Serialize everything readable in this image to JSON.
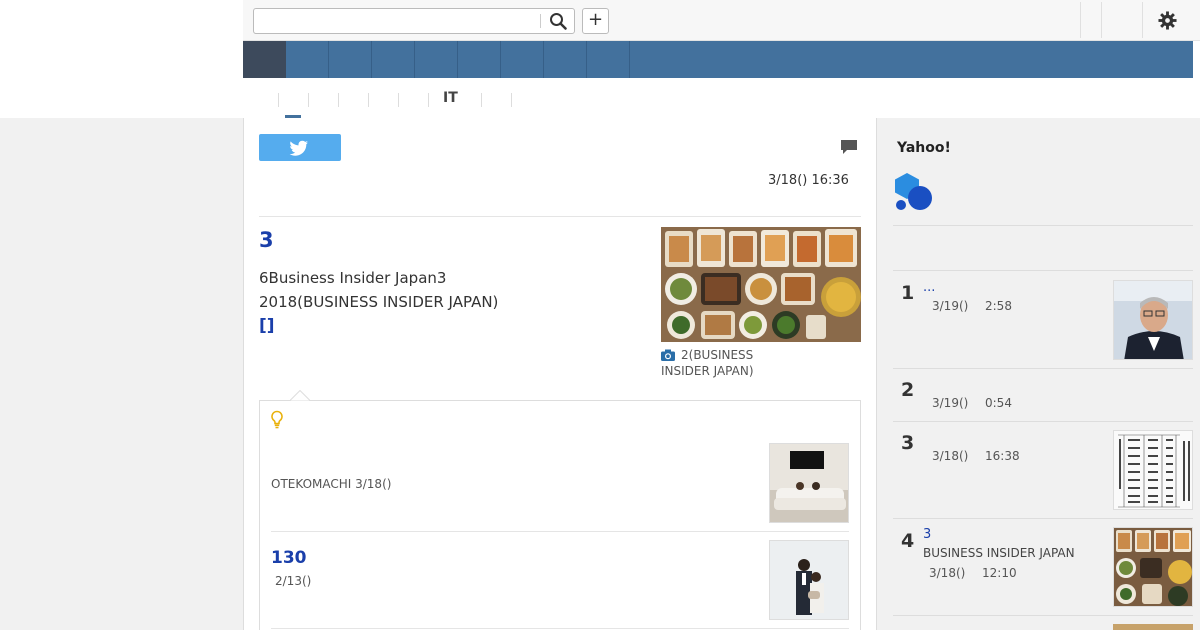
{
  "search": {
    "placeholder": "",
    "plus_label": "+"
  },
  "subnav": {
    "items": [
      "IT"
    ]
  },
  "article": {
    "date": "3/18() 16:36",
    "title": "3",
    "body_line_1": "6Business Insider Japan3",
    "body_line_2": "2018(BUSINESS INSIDER JAPAN)",
    "link": "[]",
    "photo_caption": "2(BUSINESS INSIDER JAPAN)"
  },
  "related": [
    {
      "title": "",
      "source_date": "OTEKOMACHI 3/18()"
    },
    {
      "title": "130",
      "date": "2/13()"
    }
  ],
  "sidebar": {
    "heading": "Yahoo!",
    "ranking": [
      {
        "rank": "1",
        "title": "...",
        "date": "3/19()",
        "time": "2:58",
        "source": ""
      },
      {
        "rank": "2",
        "title": "",
        "date": "3/19()",
        "time": "0:54",
        "source": ""
      },
      {
        "rank": "3",
        "title": "",
        "date": "3/18()",
        "time": "16:38",
        "source": ""
      },
      {
        "rank": "4",
        "title": "3",
        "date": "3/18()",
        "time": "12:10",
        "source": "BUSINESS INSIDER JAPAN"
      }
    ]
  },
  "colors": {
    "nav": "#43719d",
    "nav_home": "#3d4a5c",
    "link": "#1a3faa",
    "twitter": "#55acee"
  }
}
